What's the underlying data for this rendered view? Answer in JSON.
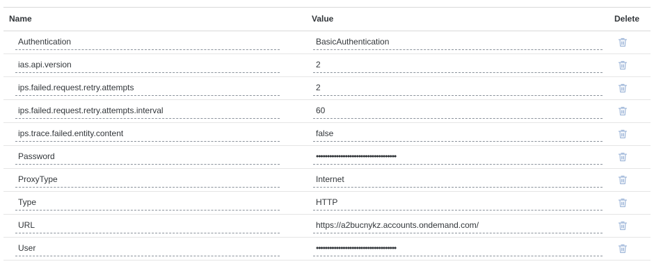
{
  "headers": {
    "name": "Name",
    "value": "Value",
    "delete": "Delete"
  },
  "rows": [
    {
      "name": "Authentication",
      "value": "BasicAuthentication"
    },
    {
      "name": "ias.api.version",
      "value": "2"
    },
    {
      "name": "ips.failed.request.retry.attempts",
      "value": "2"
    },
    {
      "name": "ips.failed.request.retry.attempts.interval",
      "value": "60"
    },
    {
      "name": "ips.trace.failed.entity.content",
      "value": "false"
    },
    {
      "name": "Password",
      "value": "••••••••••••••••••••••••••••••••••••"
    },
    {
      "name": "ProxyType",
      "value": "Internet"
    },
    {
      "name": "Type",
      "value": "HTTP"
    },
    {
      "name": "URL",
      "value": "https://a2bucnykz.accounts.ondemand.com/"
    },
    {
      "name": "User",
      "value": "••••••••••••••••••••••••••••••••••••"
    }
  ],
  "icons": {
    "delete": "trash-icon"
  },
  "colors": {
    "icon": "#9fb7d9",
    "text": "#32363a"
  }
}
